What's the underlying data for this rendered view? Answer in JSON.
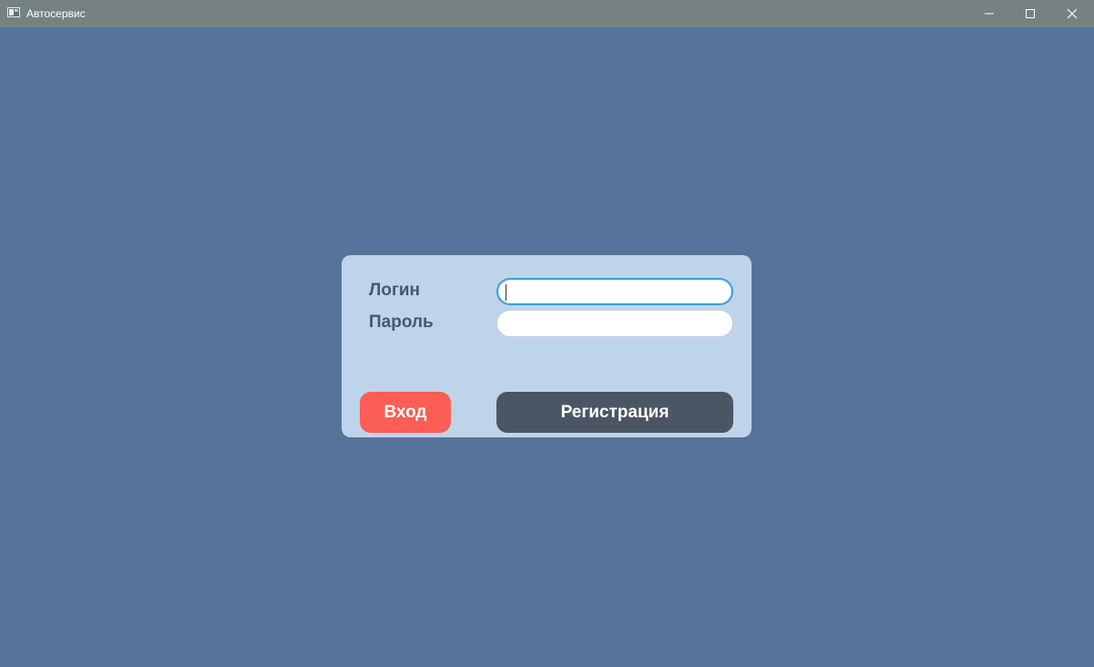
{
  "window": {
    "title": "Автосервис",
    "icon": "app-window-icon",
    "controls": [
      "minimize-icon",
      "maximize-icon",
      "close-icon"
    ]
  },
  "form": {
    "login_label": "Логин",
    "password_label": "Пароль",
    "login_value": "",
    "password_value": "",
    "login_button": "Вход",
    "register_button": "Регистрация"
  },
  "colors": {
    "background": "#567399",
    "titlebar": "#758281",
    "panel": "#bed4ea",
    "login_button": "#fa5e55",
    "register_button": "#4b5664",
    "focus_border": "#3ea0d6"
  }
}
